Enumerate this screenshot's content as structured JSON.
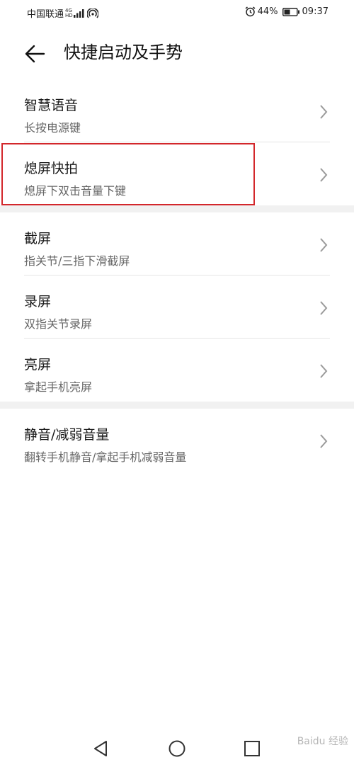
{
  "status_bar": {
    "carrier": "中国联通",
    "network_top": "4G",
    "network_bottom": "HD",
    "battery_percent": "44%",
    "time": "09:37"
  },
  "header": {
    "title": "快捷启动及手势"
  },
  "groups": [
    {
      "items": [
        {
          "title": "智慧语音",
          "subtitle": "长按电源键"
        },
        {
          "title": "熄屏快拍",
          "subtitle": "熄屏下双击音量下键"
        }
      ]
    },
    {
      "items": [
        {
          "title": "截屏",
          "subtitle": "指关节/三指下滑截屏"
        },
        {
          "title": "录屏",
          "subtitle": "双指关节录屏"
        },
        {
          "title": "亮屏",
          "subtitle": "拿起手机亮屏"
        }
      ]
    },
    {
      "items": [
        {
          "title": "静音/减弱音量",
          "subtitle": "翻转手机静音/拿起手机减弱音量"
        }
      ]
    }
  ],
  "watermark": "Baidu 经验",
  "colors": {
    "highlight_border": "#d3272b",
    "section_gap": "#f1f1f1",
    "subtitle": "#666666"
  }
}
